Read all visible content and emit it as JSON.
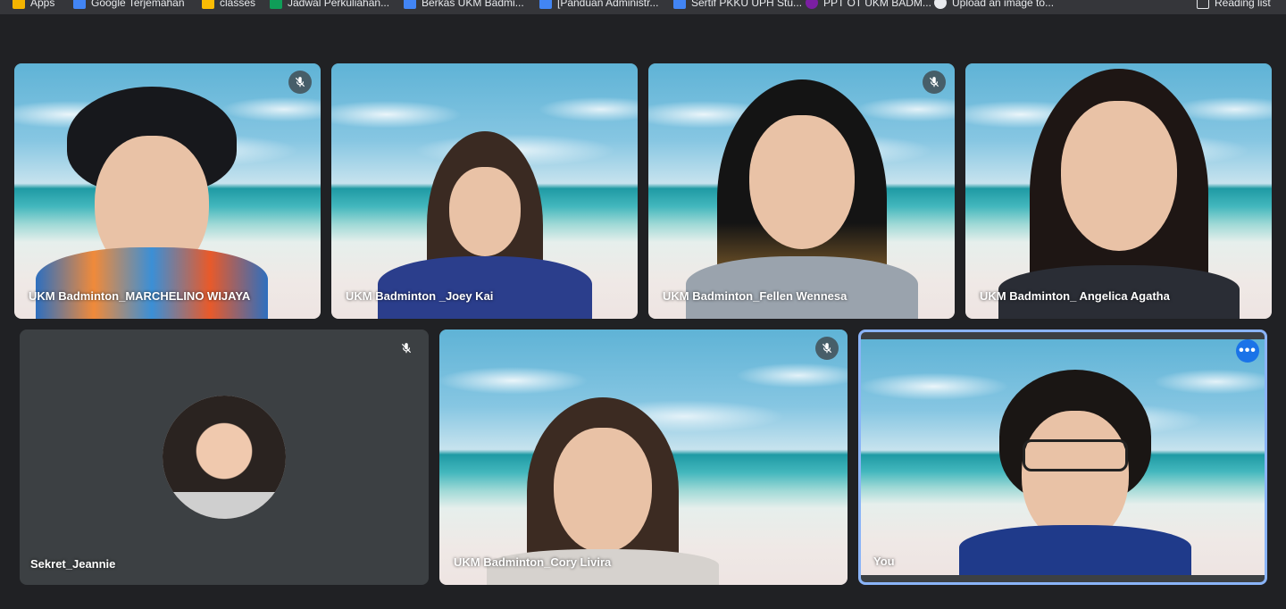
{
  "bookmarks": [
    {
      "label": "Apps",
      "icon": "apps-grid-icon",
      "color": "#f4b400"
    },
    {
      "label": "Google Terjemahan",
      "icon": "translate-icon",
      "color": "#4285f4"
    },
    {
      "label": "classes",
      "icon": "folder-icon",
      "color": "#fbbc04"
    },
    {
      "label": "Jadwal Perkuliahan...",
      "icon": "sheets-icon",
      "color": "#0f9d58"
    },
    {
      "label": "Berkas UKM Badmi...",
      "icon": "drive-icon",
      "color": "#4285f4"
    },
    {
      "label": "[Panduan Administr...",
      "icon": "drive-icon",
      "color": "#4285f4"
    },
    {
      "label": "Sertif PKKU UPH Stu...",
      "icon": "docs-icon",
      "color": "#4285f4"
    },
    {
      "label": "PPT OT UKM BADM...",
      "icon": "slides-icon",
      "color": "#7b1fa2"
    },
    {
      "label": "Upload an image to...",
      "icon": "upload-icon",
      "color": "#e8eaed"
    },
    {
      "label": "Reading list",
      "icon": "reading-list-icon",
      "color": "#e8eaed"
    }
  ],
  "participants": [
    {
      "name": "UKM Badminton_MARCHELINO WIJAYA",
      "muted": true
    },
    {
      "name": "UKM Badminton _Joey Kai",
      "muted": false
    },
    {
      "name": "UKM Badminton_Fellen Wennesa",
      "muted": true
    },
    {
      "name": "UKM Badminton_ Angelica Agatha",
      "muted": false
    },
    {
      "name": "Sekret_Jeannie",
      "muted": true,
      "camera": "off"
    },
    {
      "name": "UKM Badminton_Cory Livira",
      "muted": true
    },
    {
      "name": "You",
      "muted": false,
      "self": true
    }
  ],
  "colors": {
    "background": "#202124",
    "tile_off": "#3c4043",
    "accent": "#1a73e8",
    "self_border": "#8ab4f8"
  },
  "more_options_glyph": "•••"
}
